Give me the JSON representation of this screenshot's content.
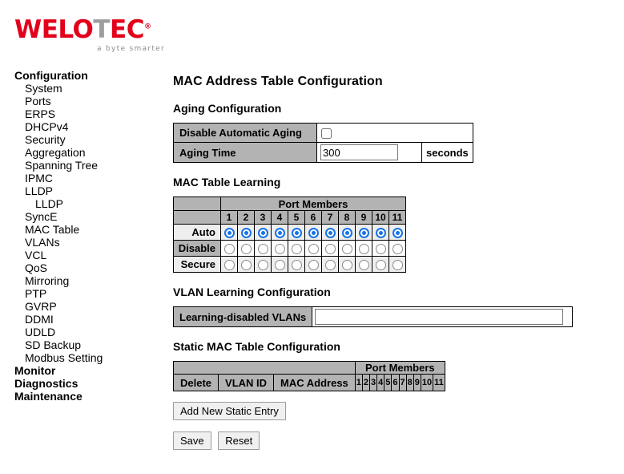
{
  "brand": {
    "name_part1": "WELO",
    "name_part2": "T",
    "name_part3": "EC",
    "registered": "®",
    "tagline": "a byte smarter",
    "primary_color": "#e2001a",
    "secondary_color": "#9c9e9f"
  },
  "sidebar": {
    "items": [
      {
        "label": "Configuration",
        "level": 0
      },
      {
        "label": "System",
        "level": 1
      },
      {
        "label": "Ports",
        "level": 1
      },
      {
        "label": "ERPS",
        "level": 1
      },
      {
        "label": "DHCPv4",
        "level": 1
      },
      {
        "label": "Security",
        "level": 1
      },
      {
        "label": "Aggregation",
        "level": 1
      },
      {
        "label": "Spanning Tree",
        "level": 1
      },
      {
        "label": "IPMC",
        "level": 1
      },
      {
        "label": "LLDP",
        "level": 1
      },
      {
        "label": "LLDP",
        "level": 2
      },
      {
        "label": "SyncE",
        "level": 1
      },
      {
        "label": "MAC Table",
        "level": 1
      },
      {
        "label": "VLANs",
        "level": 1
      },
      {
        "label": "VCL",
        "level": 1
      },
      {
        "label": "QoS",
        "level": 1
      },
      {
        "label": "Mirroring",
        "level": 1
      },
      {
        "label": "PTP",
        "level": 1
      },
      {
        "label": "GVRP",
        "level": 1
      },
      {
        "label": "DDMI",
        "level": 1
      },
      {
        "label": "UDLD",
        "level": 1
      },
      {
        "label": "SD Backup",
        "level": 1
      },
      {
        "label": "Modbus Setting",
        "level": 1
      },
      {
        "label": "Monitor",
        "level": 0
      },
      {
        "label": "Diagnostics",
        "level": 0
      },
      {
        "label": "Maintenance",
        "level": 0
      }
    ]
  },
  "main": {
    "page_title": "MAC Address Table Configuration",
    "aging": {
      "section_title": "Aging Configuration",
      "disable_auto_aging_label": "Disable Automatic Aging",
      "disable_auto_aging_checked": false,
      "aging_time_label": "Aging Time",
      "aging_time_value": "300",
      "aging_time_unit": "seconds"
    },
    "learning": {
      "section_title": "MAC Table Learning",
      "port_members_header": "Port Members",
      "ports": [
        "1",
        "2",
        "3",
        "4",
        "5",
        "6",
        "7",
        "8",
        "9",
        "10",
        "11"
      ],
      "modes": [
        "Auto",
        "Disable",
        "Secure"
      ],
      "selected_mode_per_port": [
        "Auto",
        "Auto",
        "Auto",
        "Auto",
        "Auto",
        "Auto",
        "Auto",
        "Auto",
        "Auto",
        "Auto",
        "Auto"
      ]
    },
    "vlan_learning": {
      "section_title": "VLAN Learning Configuration",
      "learning_disabled_vlans_label": "Learning-disabled VLANs",
      "learning_disabled_vlans_value": "",
      "learning_disabled_vlans_placeholder": ""
    },
    "static_table": {
      "section_title": "Static MAC Table Configuration",
      "port_members_header": "Port Members",
      "columns": [
        "Delete",
        "VLAN ID",
        "MAC Address"
      ],
      "ports": [
        "1",
        "2",
        "3",
        "4",
        "5",
        "6",
        "7",
        "8",
        "9",
        "10",
        "11"
      ],
      "rows": []
    },
    "buttons": {
      "add_new_static_entry": "Add New Static Entry",
      "save": "Save",
      "reset": "Reset"
    }
  }
}
